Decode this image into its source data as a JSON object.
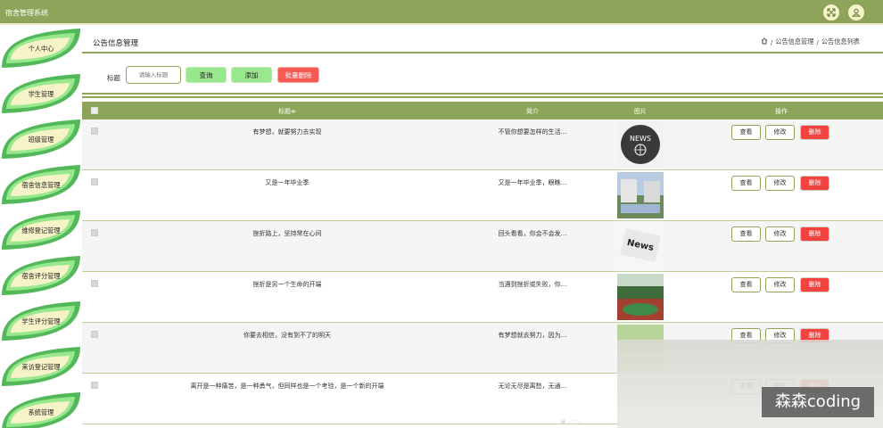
{
  "app": {
    "title": "宿舍管理系统"
  },
  "header_icons": [
    "fullscreen-icon",
    "user-icon"
  ],
  "sidebar": {
    "items": [
      {
        "label": "个人中心"
      },
      {
        "label": "学生管理"
      },
      {
        "label": "班级管理"
      },
      {
        "label": "宿舍信息管理"
      },
      {
        "label": "维修登记管理"
      },
      {
        "label": "宿舍评分管理"
      },
      {
        "label": "学生评分管理"
      },
      {
        "label": "来访登记管理"
      },
      {
        "label": "系统管理"
      }
    ]
  },
  "page": {
    "title": "公告信息管理",
    "breadcrumb": [
      "公告信息管理",
      "公告信息列表"
    ]
  },
  "search": {
    "label": "标题",
    "placeholder": "请输入标题",
    "query_button": "查询",
    "add_button": "添加",
    "batch_delete_button": "批量删除"
  },
  "table": {
    "columns": [
      "标题",
      "简介",
      "图片",
      "操作"
    ],
    "sort_indicator": "≑",
    "rows": [
      {
        "title": "有梦想，就要努力去实现",
        "summary": "不管你想要怎样的生活...",
        "image": "news-globe"
      },
      {
        "title": "又是一年毕业季",
        "summary": "又是一年毕业季，眼瞧...",
        "image": "campus"
      },
      {
        "title": "挫折路上，坚持常在心间",
        "summary": "回头看看，你会不会发...",
        "image": "newspaper"
      },
      {
        "title": "挫折是另一个生命的开端",
        "summary": "当遇到挫折或失败，你...",
        "image": "playground"
      },
      {
        "title": "你要去相信，没有到不了的明天",
        "summary": "有梦想就去努力，因为...",
        "image": "beach"
      },
      {
        "title": "离开是一种痛苦，是一种勇气，但同样也是一个考验，是一个新的开端",
        "summary": "无论无尽是离愁，无通...",
        "image": "none"
      }
    ],
    "actions": {
      "view": "查看",
      "edit": "修改",
      "delete": "删除"
    }
  },
  "watermark": "森森coding",
  "colors": {
    "primary": "#8ea45a",
    "accent_green": "#98e88e",
    "danger": "#f4433f"
  }
}
